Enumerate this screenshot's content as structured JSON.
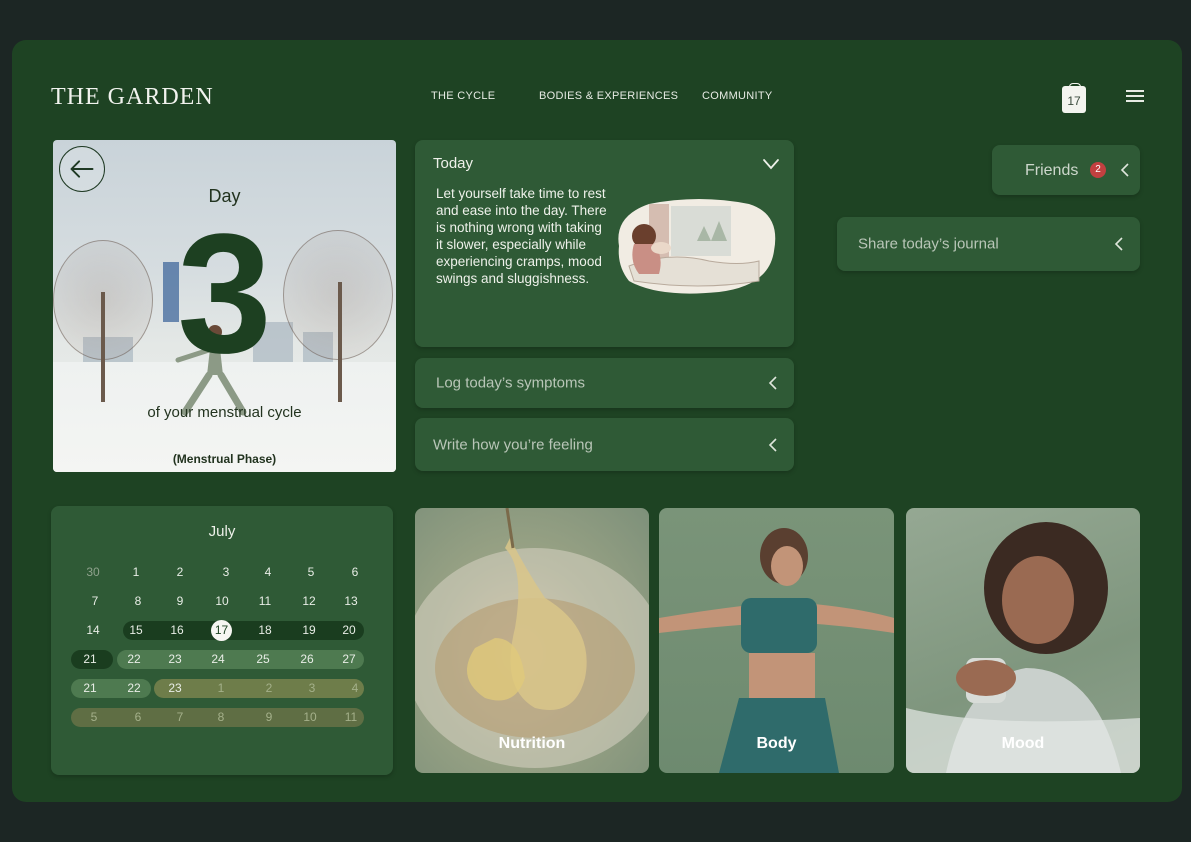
{
  "brand": {
    "logo": "THE GARDEN"
  },
  "nav": [
    {
      "label": "THE CYCLE"
    },
    {
      "label": "BODIES & EXPERIENCES"
    },
    {
      "label": "COMMUNITY"
    }
  ],
  "header": {
    "calendar_icon_day": "17",
    "calendar_icon": "calendar-icon",
    "menu_icon": "hamburger-menu-icon"
  },
  "day_card": {
    "day_label": "Day",
    "day_number": "3",
    "cycle_text": "of your menstrual cycle",
    "phase": "(Menstrual Phase)",
    "back_icon": "arrow-left-icon"
  },
  "today": {
    "title": "Today",
    "text": "Let yourself take time to rest and ease into the day. There is nothing wrong with taking it slower, especially while experiencing cramps, mood swings and sluggishness."
  },
  "actions": {
    "log_symptoms": "Log today’s symptoms",
    "write_feeling": "Write how you’re feeling",
    "share_journal": "Share today’s journal"
  },
  "friends": {
    "label": "Friends",
    "count": "2"
  },
  "calendar": {
    "month": "July",
    "today": "17",
    "weeks": [
      [
        "30",
        "1",
        "2",
        "3",
        "4",
        "5",
        "6"
      ],
      [
        "7",
        "8",
        "9",
        "10",
        "11",
        "12",
        "13"
      ],
      [
        "14",
        "15",
        "16",
        "17",
        "18",
        "19",
        "20"
      ],
      [
        "21",
        "22",
        "23",
        "24",
        "25",
        "26",
        "27"
      ],
      [
        "21",
        "22",
        "23",
        "1",
        "2",
        "3",
        "4"
      ],
      [
        "5",
        "6",
        "7",
        "8",
        "9",
        "10",
        "11"
      ]
    ]
  },
  "tiles": [
    {
      "label": "Nutrition"
    },
    {
      "label": "Body"
    },
    {
      "label": "Mood"
    }
  ],
  "colors": {
    "background": "#1c2624",
    "frame": "#1e4323",
    "panel": "#2f5a36",
    "badge": "#c24040",
    "period_band": "#1a3d1f",
    "phase_band": "#4e7a50",
    "fertile_band": "#6e7d4a",
    "next_band": "#5f6e44"
  }
}
